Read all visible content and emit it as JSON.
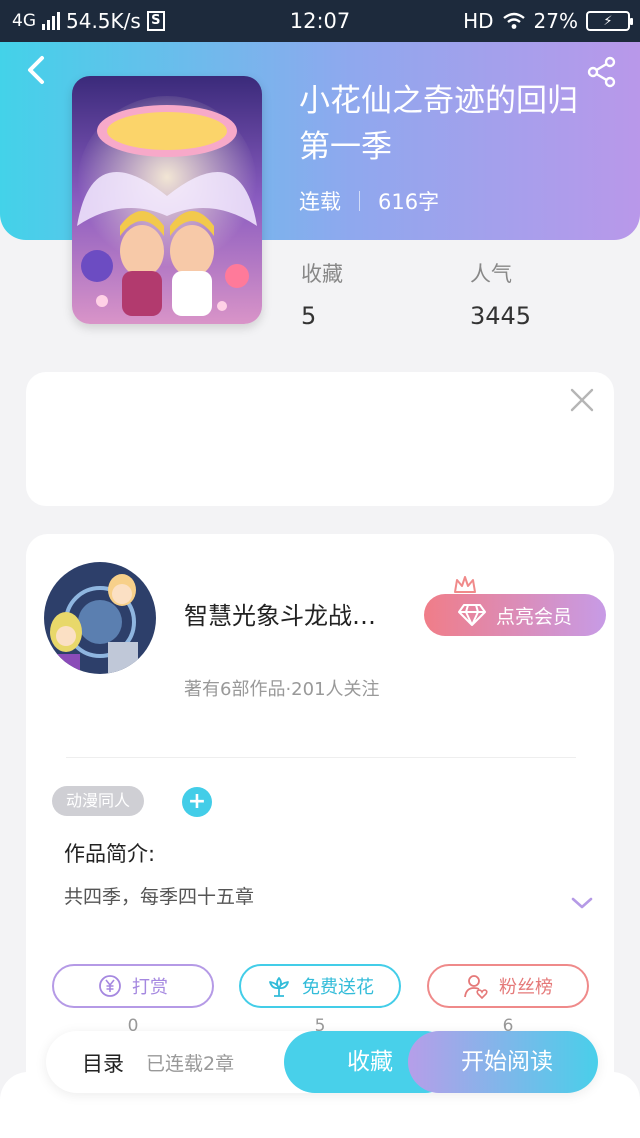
{
  "status_bar": {
    "network": "4G",
    "speed": "54.5K/s",
    "sim_badge": "S",
    "time": "12:07",
    "hd": "HD",
    "battery": "27%"
  },
  "book": {
    "title": "小花仙之奇迹的回归第一季",
    "status": "连载",
    "word_count": "616字",
    "stats": {
      "favorites_label": "收藏",
      "favorites_value": "5",
      "popularity_label": "人气",
      "popularity_value": "3445"
    }
  },
  "author": {
    "name": "智慧光象斗龙战…",
    "info": "著有6部作品·201人关注",
    "vip_label": "点亮会员"
  },
  "tags": [
    "动漫同人"
  ],
  "add_tag_label": "+",
  "intro": {
    "title": "作品简介:",
    "text": "共四季，每季四十五章"
  },
  "actions": [
    {
      "label": "打赏",
      "count": "0"
    },
    {
      "label": "免费送花",
      "count": "5"
    },
    {
      "label": "粉丝榜",
      "count": "6"
    }
  ],
  "bottom_bar": {
    "toc_label": "目录",
    "toc_count": "已连载2章",
    "favorite_label": "收藏",
    "read_label": "开始阅读"
  },
  "icons": {
    "back": "back-chevron-icon",
    "share": "share-icon",
    "close": "close-icon",
    "expand": "chevron-down-icon",
    "vip": "diamond-icon",
    "crown": "crown-icon",
    "reward": "yen-coin-icon",
    "flower": "flower-icon",
    "fans": "user-heart-icon"
  },
  "colors": {
    "accent_cyan": "#43cde8",
    "accent_purple": "#b59ae6",
    "accent_red": "#ef8a8a"
  }
}
